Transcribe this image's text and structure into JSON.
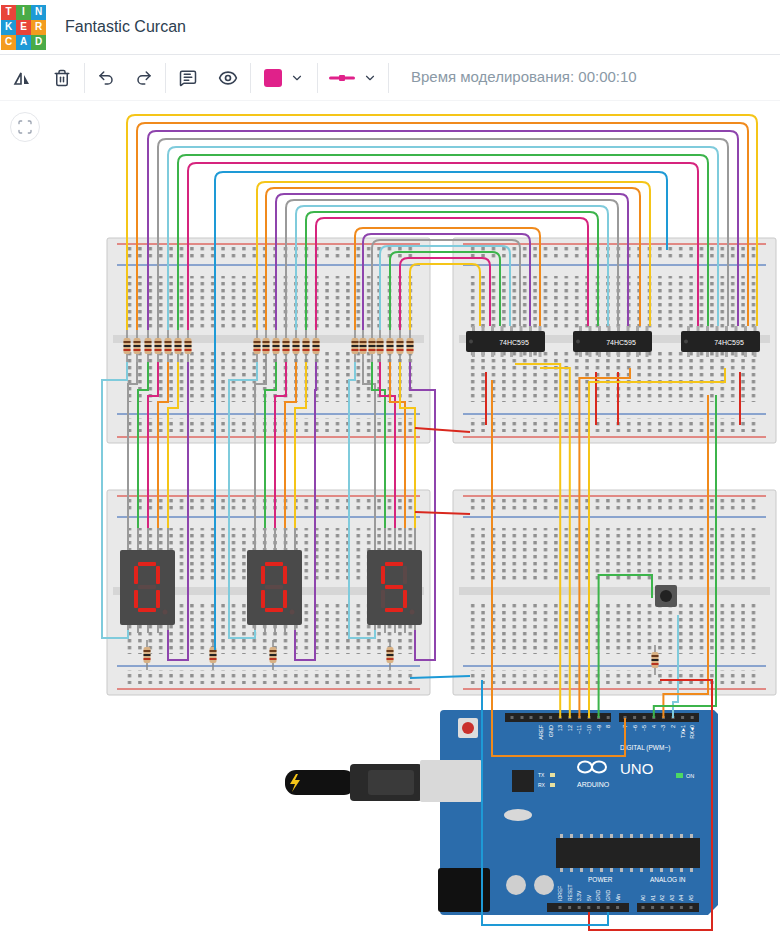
{
  "header": {
    "logo_letters": [
      "T",
      "I",
      "N",
      "K",
      "E",
      "R",
      "C",
      "A",
      "D"
    ],
    "title": "Fantastic Curcan"
  },
  "toolbar": {
    "simulation_time": "Время моделирования: 00:00:10"
  },
  "chips": [
    {
      "label": "74HC595"
    },
    {
      "label": "74HC595"
    },
    {
      "label": "74HC595"
    }
  ],
  "displays": [
    {
      "segments": [
        true,
        true,
        true,
        true,
        true,
        true,
        false
      ]
    },
    {
      "segments": [
        true,
        true,
        true,
        true,
        true,
        true,
        false
      ]
    },
    {
      "segments": [
        true,
        false,
        true,
        true,
        false,
        true,
        true
      ]
    }
  ],
  "arduino": {
    "model": "UNO",
    "brand": "ARDUINO",
    "digital_label": "DIGITAL (PWM~)",
    "digital_pins_left": [
      "AREF",
      "GND",
      "13",
      "12",
      "~11",
      "~10",
      "~9",
      "8"
    ],
    "digital_pins_right": [
      "7",
      "~6",
      "~5",
      "4",
      "~3",
      "2",
      "TX▸1",
      "RX◂0"
    ],
    "serial_leds": [
      "TX",
      "RX"
    ],
    "on_label": "ON",
    "power_led_on": true,
    "power_label": "POWER",
    "analog_label": "ANALOG IN",
    "power_pins": [
      "IOREF",
      "RESET",
      "3.3V",
      "5V",
      "GND",
      "GND",
      "Vin"
    ],
    "analog_pins": [
      "A0",
      "A1",
      "A2",
      "A3",
      "A4",
      "A5"
    ]
  }
}
